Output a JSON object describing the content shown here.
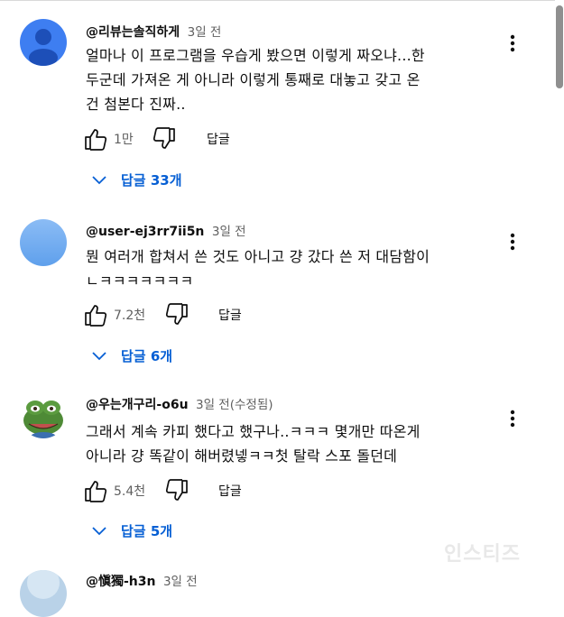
{
  "comments": [
    {
      "author": "@리뷰는솔직하게",
      "time": "3일 전",
      "text_lines": [
        "얼마나 이 프로그램을 우습게 봤으면 이렇게 짜오냐...한",
        "두군데 가져온 게 아니라 이렇게 통째로 대놓고 갖고 온",
        "건 첨본다 진짜.."
      ],
      "likes": "1만",
      "reply_label": "답글",
      "replies_label": "답글 33개"
    },
    {
      "author": "@user-ej3rr7ii5n",
      "time": "3일 전",
      "text_lines": [
        "뭔 여러개 합쳐서 쓴 것도 아니고 걍 갔다 쓴 저 대담함이",
        "ㄴㅋㅋㅋㅋㅋㅋㅋ"
      ],
      "likes": "7.2천",
      "reply_label": "답글",
      "replies_label": "답글 6개"
    },
    {
      "author": "@우는개구리-o6u",
      "time": "3일 전(수정됨)",
      "text_lines": [
        "그래서 계속 카피 했다고 했구나..ㅋㅋㅋ  몇개만 따온게",
        "아니라 걍 똑같이 해버렸넿ㅋㅋ첫 탈락 스포 돌던데"
      ],
      "likes": "5.4천",
      "reply_label": "답글",
      "replies_label": "답글 5개"
    },
    {
      "author": "@愼獨-h3n",
      "time": "3일 전"
    }
  ],
  "watermark": "인스티즈",
  "colors": {
    "link": "#065fd4",
    "secondary": "#606060",
    "text": "#0f0f0f"
  },
  "icons": [
    "avatar-default-icon",
    "kebab-menu-icon",
    "thumbs-up-icon",
    "thumbs-down-icon",
    "chevron-down-icon",
    "frog-avatar"
  ]
}
